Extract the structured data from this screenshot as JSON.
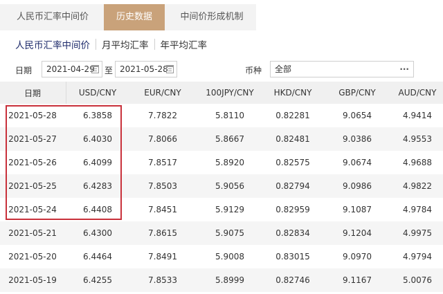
{
  "top_tabs": [
    "人民币汇率中间价",
    "历史数据",
    "中间价形成机制"
  ],
  "sub_tabs": [
    "人民币汇率中间价",
    "月平均汇率",
    "年平均汇率"
  ],
  "filter": {
    "date_label": "日期",
    "start_date": "2021-04-29",
    "to_label": "至",
    "end_date": "2021-05-28",
    "currency_label": "币种",
    "currency_value": "全部",
    "more": "···"
  },
  "table": {
    "headers": [
      "日期",
      "USD/CNY",
      "EUR/CNY",
      "100JPY/CNY",
      "HKD/CNY",
      "GBP/CNY",
      "AUD/CNY"
    ],
    "rows": [
      [
        "2021-05-28",
        "6.3858",
        "7.7822",
        "5.8110",
        "0.82281",
        "9.0654",
        "4.9414"
      ],
      [
        "2021-05-27",
        "6.4030",
        "7.8066",
        "5.8667",
        "0.82481",
        "9.0386",
        "4.9553"
      ],
      [
        "2021-05-26",
        "6.4099",
        "7.8517",
        "5.8920",
        "0.82575",
        "9.0674",
        "4.9688"
      ],
      [
        "2021-05-25",
        "6.4283",
        "7.8503",
        "5.9056",
        "0.82794",
        "9.0986",
        "4.9822"
      ],
      [
        "2021-05-24",
        "6.4408",
        "7.8451",
        "5.9129",
        "0.82959",
        "9.1087",
        "4.9784"
      ],
      [
        "2021-05-21",
        "6.4300",
        "7.8615",
        "5.9075",
        "0.82834",
        "9.1204",
        "4.9975"
      ],
      [
        "2021-05-20",
        "6.4464",
        "7.8491",
        "5.9008",
        "0.83015",
        "9.0970",
        "4.9794"
      ],
      [
        "2021-05-19",
        "6.4255",
        "7.8533",
        "5.8999",
        "0.82746",
        "9.1167",
        "5.0076"
      ]
    ]
  },
  "colors": {
    "active_tab_bg": "#c9a27a",
    "active_subtab_text": "#1e2b6b",
    "highlight_border": "#c8303a"
  }
}
